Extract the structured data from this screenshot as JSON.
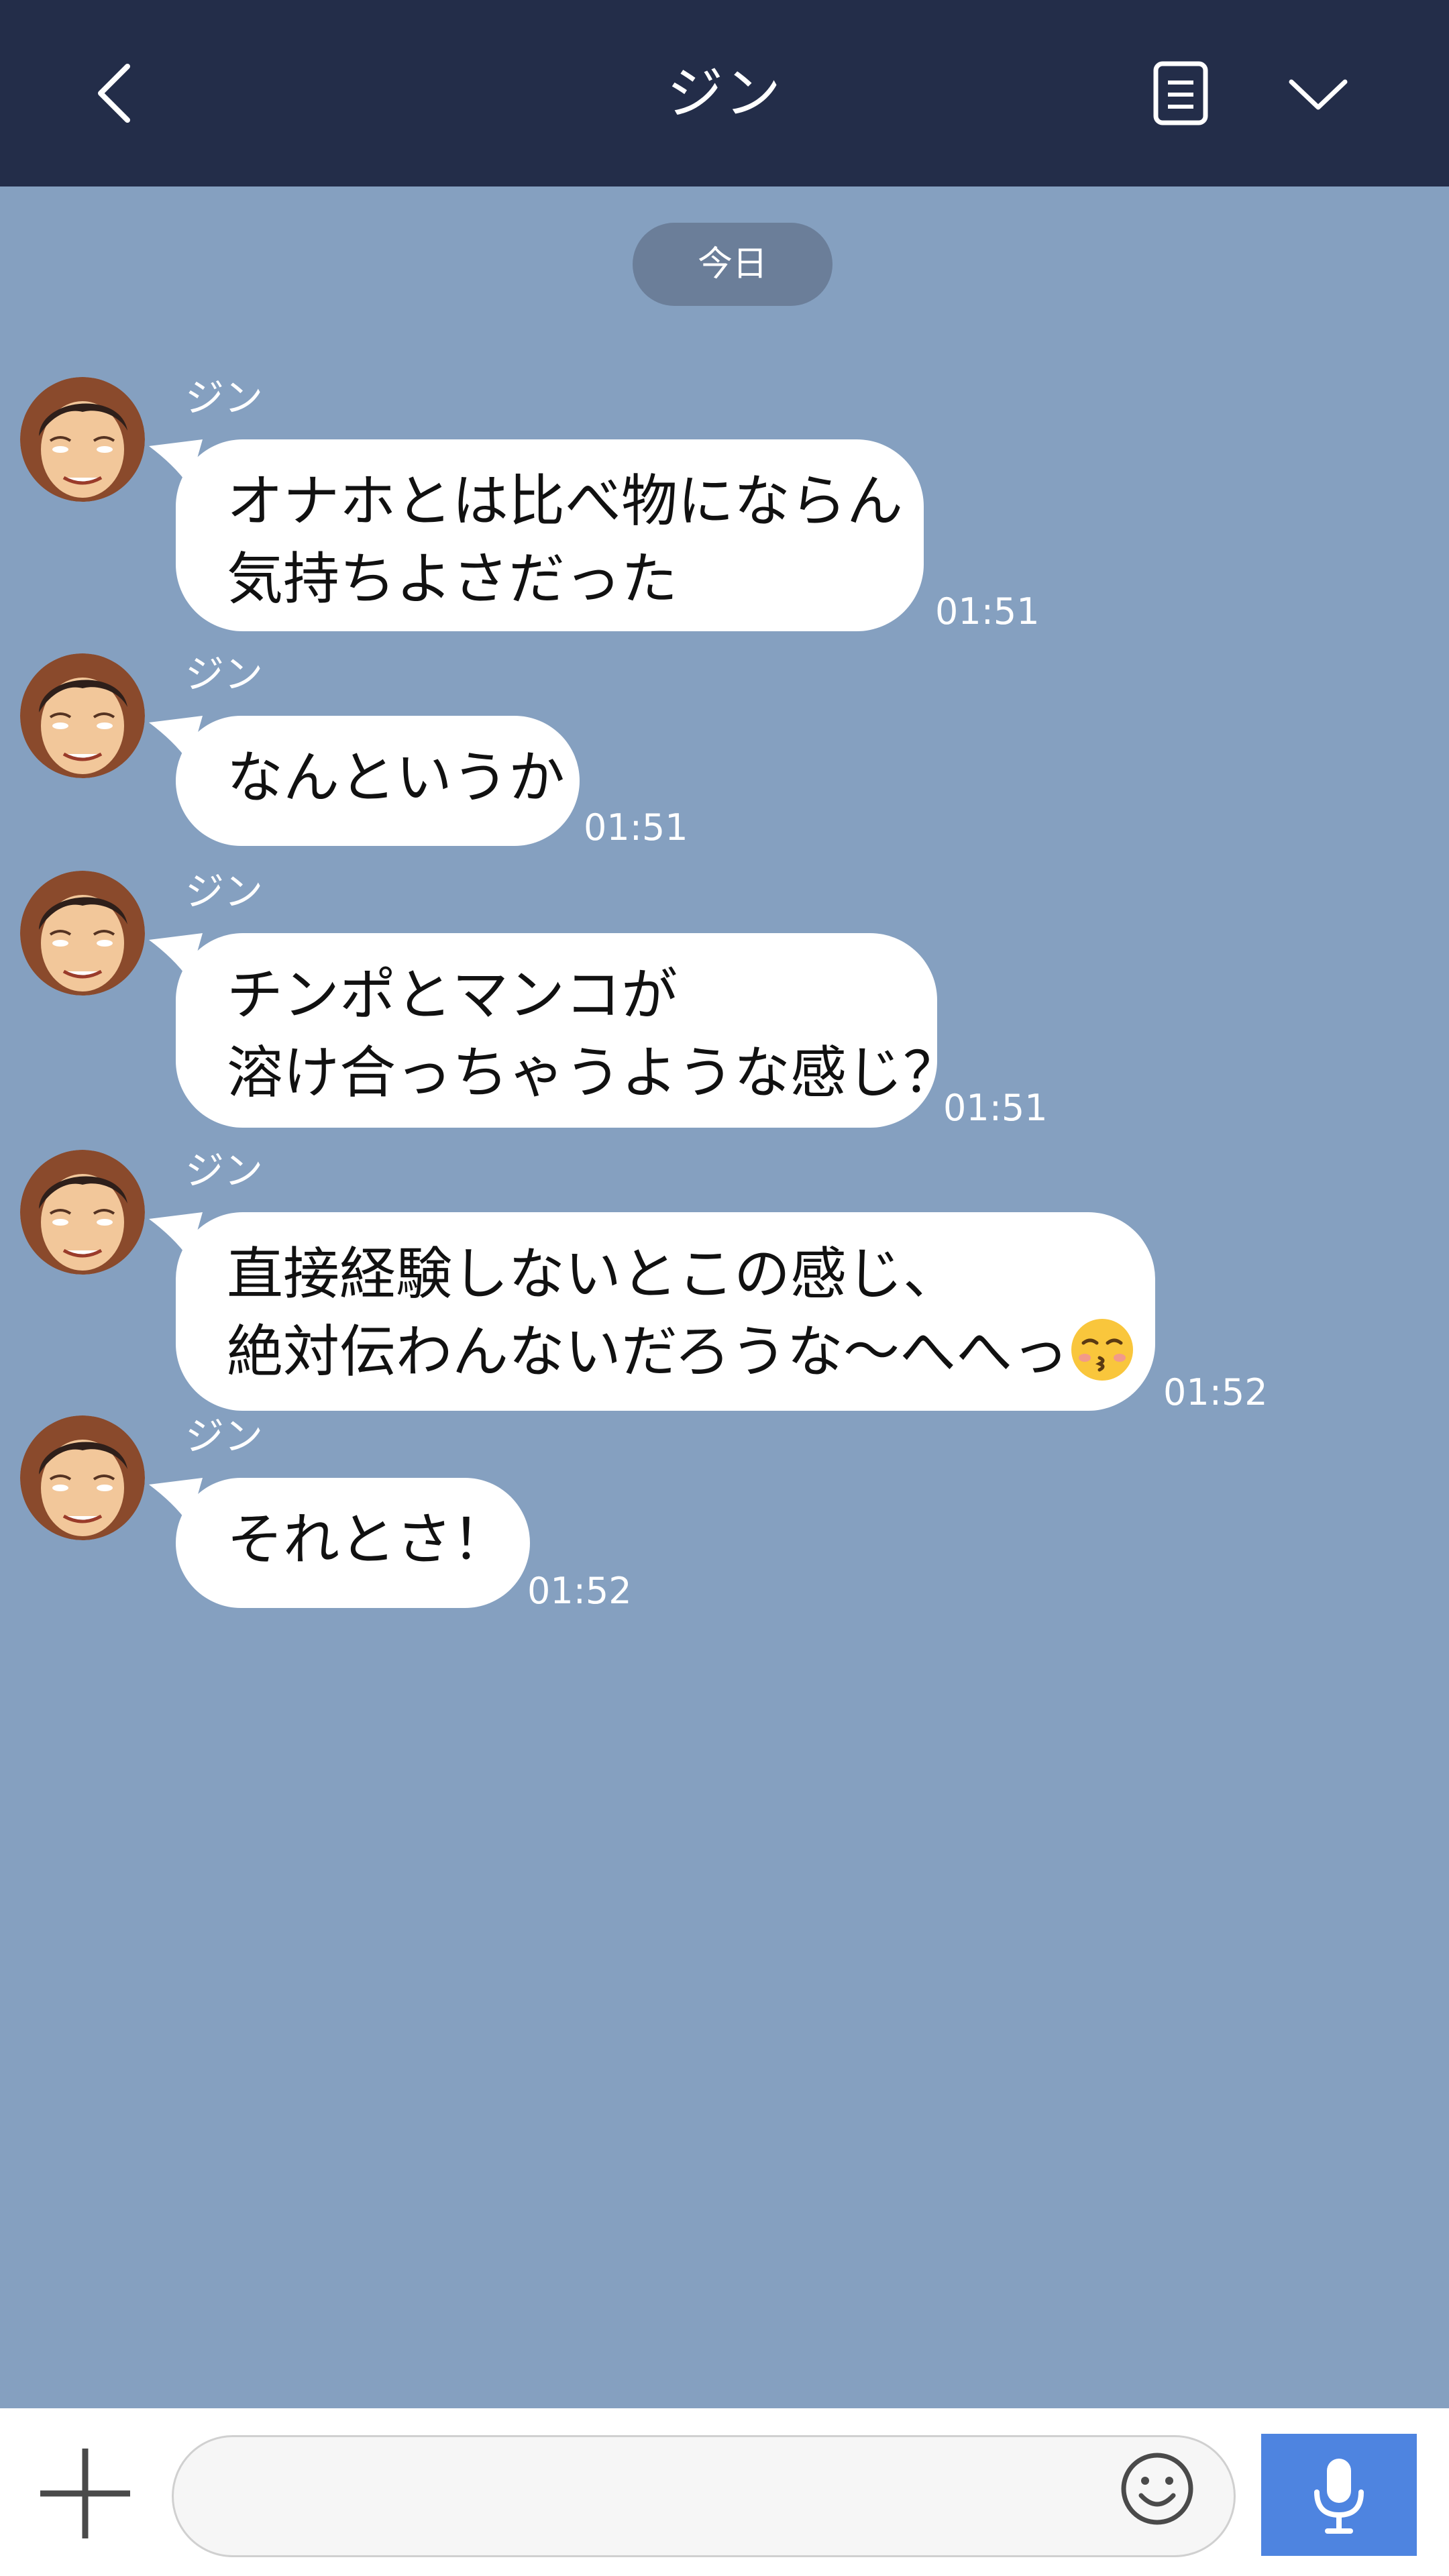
{
  "header": {
    "title": "ジン",
    "back_icon": "chevron-left-icon",
    "memo_icon": "note-icon",
    "menu_icon": "chevron-down-icon"
  },
  "date_label": "今日",
  "messages": [
    {
      "sender": "ジン",
      "line1": "オナホとは比べ物にならん",
      "line2": "気持ちよさだった",
      "time": "01:51"
    },
    {
      "sender": "ジン",
      "line1": "なんというか",
      "time": "01:51"
    },
    {
      "sender": "ジン",
      "line1": "チンポとマンコが",
      "line2": "溶け合っちゃうような感じ？",
      "time": "01:51"
    },
    {
      "sender": "ジン",
      "line1": "直接経験しないとこの感じ、",
      "line2": "絶対伝わんないだろうな～へへっ",
      "emoji": "kissing-face-icon",
      "time": "01:52"
    },
    {
      "sender": "ジン",
      "line1": "それとさ！",
      "time": "01:52"
    }
  ],
  "footer": {
    "plus_icon": "plus-icon",
    "input_value": "",
    "emoji_icon": "smiley-icon",
    "mic_icon": "microphone-icon"
  },
  "colors": {
    "header_bg": "#232d49",
    "chat_bg": "#85a0c0",
    "date_pill": "#6b7e99",
    "mic_button": "#4e84e0"
  }
}
